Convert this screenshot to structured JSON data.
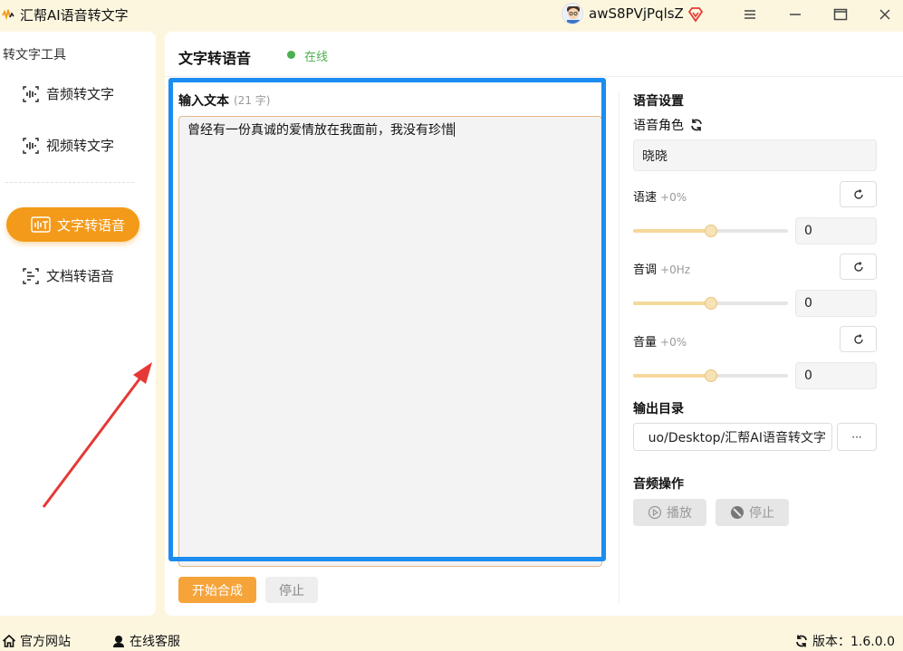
{
  "window": {
    "title": "汇帮AI语音转文字",
    "username": "awS8PVjPqlsZ"
  },
  "sidebar": {
    "section_title": "转文字工具",
    "items": [
      {
        "label": "音频转文字",
        "icon": "audio-wave-icon"
      },
      {
        "label": "视频转文字",
        "icon": "video-wave-icon"
      },
      {
        "label": "文字转语音",
        "icon": "text-to-speech-icon",
        "active": true
      },
      {
        "label": "文档转语音",
        "icon": "document-speech-icon"
      }
    ]
  },
  "main": {
    "title": "文字转语音",
    "status": "在线",
    "input_label": "输入文本",
    "char_count": "(21 字)",
    "input_text": "曾经有一份真诚的爱情放在我面前，我没有珍惜",
    "start_button": "开始合成",
    "stop_button": "停止"
  },
  "settings": {
    "title": "语音设置",
    "role_label": "语音角色",
    "role_value": "晓晓",
    "speed": {
      "label": "语速",
      "sub": "+0%",
      "value": "0",
      "slider_fraction": 0.5
    },
    "pitch": {
      "label": "音调",
      "sub": "+0Hz",
      "value": "0",
      "slider_fraction": 0.5
    },
    "volume": {
      "label": "音量",
      "sub": "+0%",
      "value": "0",
      "slider_fraction": 0.5
    },
    "output_title": "输出目录",
    "output_path": "uo/Desktop/汇帮AI语音转文字",
    "browse_label": "···",
    "ops_title": "音频操作",
    "play_button": "播放",
    "stop_button": "停止"
  },
  "footer": {
    "website": "官方网站",
    "support": "在线客服",
    "version": "版本：1.6.0.0"
  },
  "colors": {
    "accent": "#f39a1a",
    "background": "#fdf6df",
    "highlight_frame": "#1b8cf0",
    "annotation_arrow": "#e53935",
    "online": "#4caf50"
  }
}
